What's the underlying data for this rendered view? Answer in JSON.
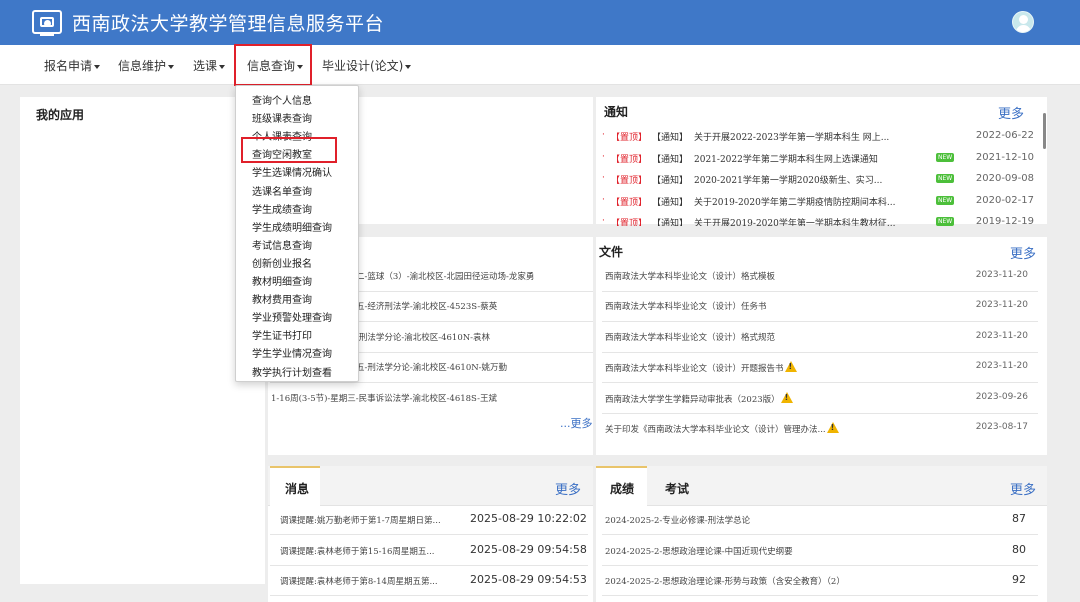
{
  "header": {
    "title": "西南政法大学教学管理信息服务平台"
  },
  "nav": {
    "items": [
      "报名申请",
      "信息维护",
      "选课",
      "信息查询",
      "毕业设计(论文)"
    ]
  },
  "dropdown": {
    "items": [
      "查询个人信息",
      "班级课表查询",
      "个人课表查询",
      "查询空闲教室",
      "学生选课情况确认",
      "选课名单查询",
      "学生成绩查询",
      "学生成绩明细查询",
      "考试信息查询",
      "创新创业报名",
      "教材明细查询",
      "教材费用查询",
      "学业预警处理查询",
      "学生证书打印",
      "学生学业情况查询",
      "教学执行计划查看"
    ]
  },
  "my_apps": {
    "title": "我的应用"
  },
  "notice": {
    "title": "通知",
    "more": "更多",
    "rows": [
      {
        "top": "【置顶】",
        "type": "【通知】",
        "text": "关于开展2022-2023学年第一学期本科生 网上...",
        "date": "2022-06-22",
        "new": ""
      },
      {
        "top": "【置顶】",
        "type": "【通知】",
        "text": "2021-2022学年第二学期本科生网上选课通知",
        "date": "2021-12-10",
        "new": "NEW"
      },
      {
        "top": "【置顶】",
        "type": "【通知】",
        "text": "2020-2021学年第一学期2020级新生、实习...",
        "date": "2020-09-08",
        "new": "NEW"
      },
      {
        "top": "【置顶】",
        "type": "【通知】",
        "text": "关于2019-2020学年第二学期疫情防控期间本科...",
        "date": "2020-02-17",
        "new": "NEW"
      },
      {
        "top": "【置顶】",
        "type": "【通知】",
        "text": "关于开展2019-2020学年第一学期本科生教材征...",
        "date": "2019-12-19",
        "new": "NEW"
      }
    ]
  },
  "courses": {
    "rows": [
      "二-篮球（3）-渝北校区-北园田径运动场-龙家勇",
      "五-经济刑法学-渝北校区-4523S-蔡英",
      "-刑法学分论-渝北校区-4610N-袁林",
      "五-刑法学分论-渝北校区-4610N-姚万勤",
      "1-16周(3-5节)-星期三-民事诉讼法学-渝北校区-4618S-王斌"
    ],
    "more": "...更多"
  },
  "files": {
    "title": "文件",
    "more": "更多",
    "rows": [
      {
        "text": "西南政法大学本科毕业论文（设计）格式模板",
        "date": "2023-11-20",
        "warn": false
      },
      {
        "text": "西南政法大学本科毕业论文（设计）任务书",
        "date": "2023-11-20",
        "warn": false
      },
      {
        "text": "西南政法大学本科毕业论文（设计）格式规范",
        "date": "2023-11-20",
        "warn": false
      },
      {
        "text": "西南政法大学本科毕业论文（设计）开题报告书",
        "date": "2023-11-20",
        "warn": true
      },
      {
        "text": "西南政法大学学生学籍异动审批表（2023版）",
        "date": "2023-09-26",
        "warn": true
      },
      {
        "text": "关于印发《西南政法大学本科毕业论文（设计）管理办法...",
        "date": "2023-08-17",
        "warn": true
      }
    ]
  },
  "messages": {
    "tab": "消息",
    "more": "更多",
    "rows": [
      {
        "text": "调课提醒:姚万勤老师于第1-7周星期日第...",
        "date": "2025-08-29 10:22:02"
      },
      {
        "text": "调课提醒:袁林老师于第15-16周星期五...",
        "date": "2025-08-29 09:54:58"
      },
      {
        "text": "调课提醒:袁林老师于第8-14周星期五第...",
        "date": "2025-08-29 09:54:53"
      }
    ]
  },
  "grades": {
    "tabs": [
      "成绩",
      "考试"
    ],
    "more": "更多",
    "rows": [
      {
        "text": "2024-2025-2-专业必修课-刑法学总论",
        "score": "87"
      },
      {
        "text": "2024-2025-2-思想政治理论课-中国近现代史纲要",
        "score": "80"
      },
      {
        "text": "2024-2025-2-思想政治理论课-形势与政策（含安全教育）（2）",
        "score": "92"
      }
    ]
  }
}
